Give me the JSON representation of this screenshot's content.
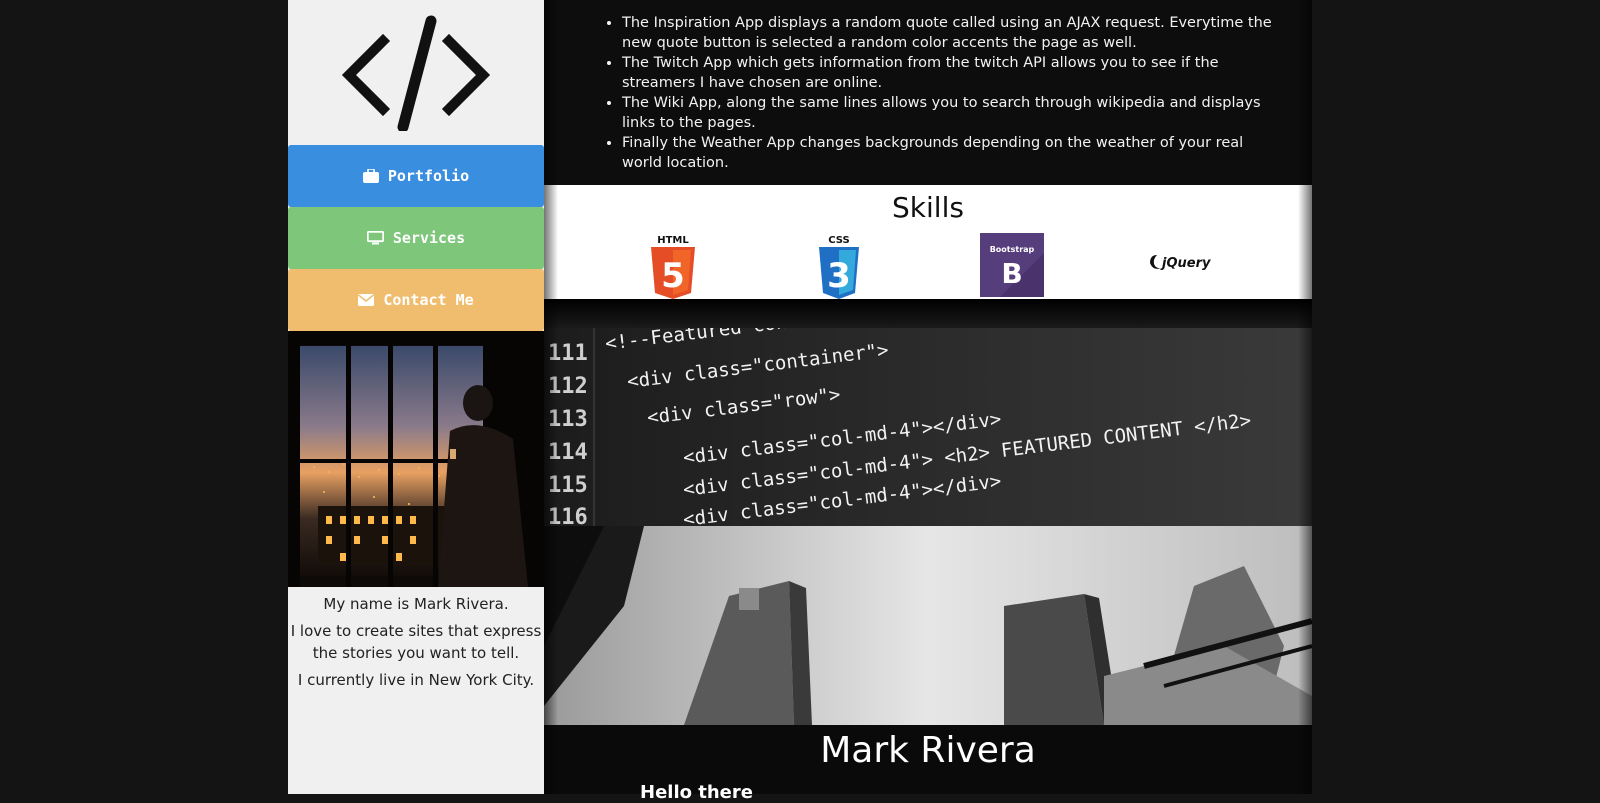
{
  "sidebar": {
    "logo_icon": "code-brackets-icon",
    "nav": [
      {
        "label": "Portfolio",
        "icon": "briefcase-icon",
        "color": "#3a8ee0"
      },
      {
        "label": "Services",
        "icon": "monitor-icon",
        "color": "#7dc67a"
      },
      {
        "label": "Contact Me",
        "icon": "envelope-icon",
        "color": "#f0bd6e"
      }
    ],
    "bio": [
      "My name is Mark Rivera.",
      "I love to create sites that express the stories you want to tell.",
      "I currently live in New York City."
    ]
  },
  "apps": [
    "The Inspiration App displays a random quote called using an AJAX request. Everytime the new quote button is selected a random color accents the page as well.",
    "The Twitch App which gets information from the twitch API allows you to see if the streamers I have chosen are online.",
    "The Wiki App, along the same lines allows you to search through wikipedia and displays links to the pages.",
    "Finally the Weather App changes backgrounds depending on the weather of your real world location."
  ],
  "skills": {
    "title": "Skills",
    "items": [
      {
        "name": "HTML",
        "badge": "5",
        "color": "#e44d26"
      },
      {
        "name": "CSS",
        "badge": "3",
        "color": "#1f6fc5"
      },
      {
        "name": "Bootstrap",
        "badge": "B",
        "color": "#563d7c"
      },
      {
        "name": "jQuery",
        "color": "#0b0b0b"
      }
    ]
  },
  "code_lines": {
    "numbers": [
      "111",
      "112",
      "113",
      "114",
      "115",
      "116"
    ],
    "text": [
      "<!--Featured cont",
      "<div class=\"container\">",
      "<div class=\"row\">",
      "<div class=\"col-md-4\"></div>",
      "<div class=\"col-md-4\"> <h2> FEATURED CONTENT </h2>",
      "<div class=\"col-md-4\"></div>"
    ]
  },
  "header": {
    "name": "Mark Rivera",
    "greeting": "Hello there"
  }
}
